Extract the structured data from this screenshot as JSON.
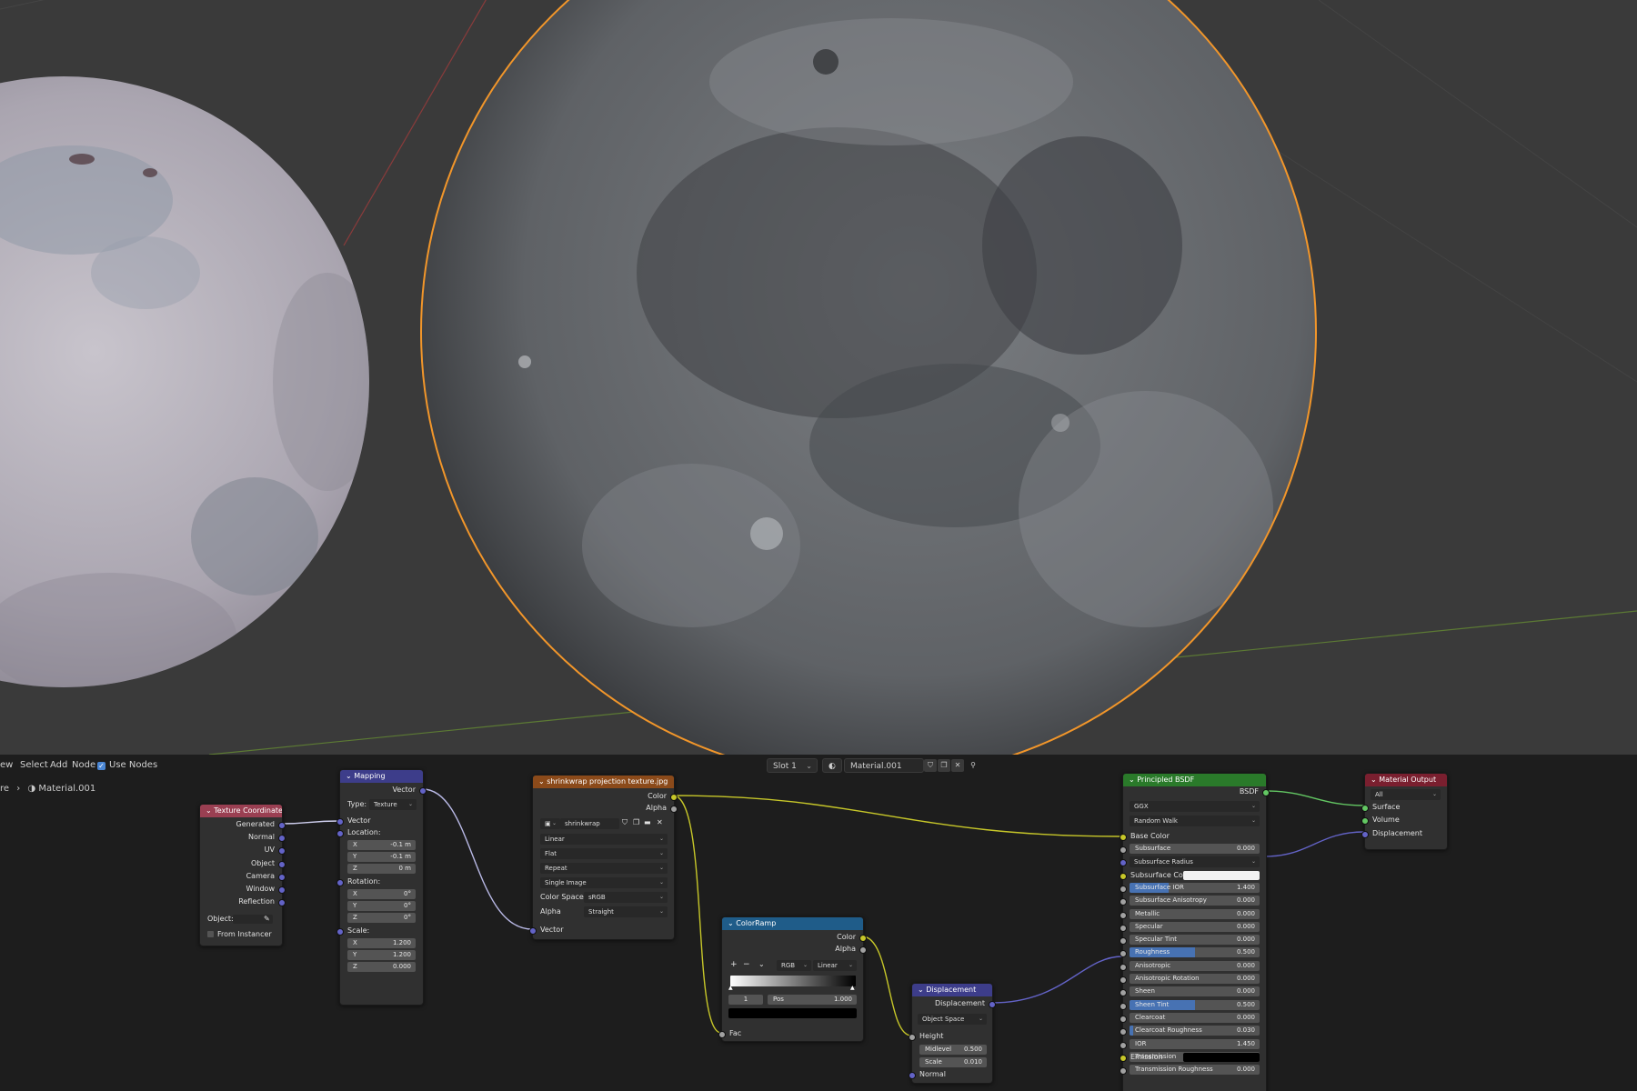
{
  "colors": {
    "texture_coordinate_header": "#9a3f52",
    "mapping_header": "#3d3d8a",
    "image_texture_header": "#8b4a1a",
    "colorramp_header": "#1f5c89",
    "displacement_header": "#3d3d8a",
    "principled_header": "#2a7a2a",
    "output_header": "#7a1f2f",
    "socket_vector": "#6363c7",
    "socket_color": "#c7c729",
    "socket_float": "#a1a1a1",
    "socket_shader": "#63c763",
    "selection_outline": "#f2962a"
  },
  "header": {
    "view_label": "ew",
    "select_label": "Select",
    "add_label": "Add",
    "node_label": "Node",
    "use_nodes_label": "Use Nodes",
    "slot_label": "Slot 1",
    "material_name": "Material.001"
  },
  "breadcrumb": {
    "prefix": "re",
    "separator": "›",
    "material": "Material.001"
  },
  "nodes": {
    "texture_coordinate": {
      "title": "Texture Coordinate",
      "outputs": [
        "Generated",
        "Normal",
        "UV",
        "Object",
        "Camera",
        "Window",
        "Reflection"
      ],
      "object_label": "Object:",
      "from_instancer": "From Instancer"
    },
    "mapping": {
      "title": "Mapping",
      "output": "Vector",
      "type_label": "Type:",
      "type_value": "Texture",
      "vector_input": "Vector",
      "location_label": "Location:",
      "location": [
        {
          "axis": "X",
          "value": "-0.1 m"
        },
        {
          "axis": "Y",
          "value": "-0.1 m"
        },
        {
          "axis": "Z",
          "value": "0 m"
        }
      ],
      "rotation_label": "Rotation:",
      "rotation": [
        {
          "axis": "X",
          "value": "0°"
        },
        {
          "axis": "Y",
          "value": "0°"
        },
        {
          "axis": "Z",
          "value": "0°"
        }
      ],
      "scale_label": "Scale:",
      "scale": [
        {
          "axis": "X",
          "value": "1.200"
        },
        {
          "axis": "Y",
          "value": "1.200"
        },
        {
          "axis": "Z",
          "value": "0.000"
        }
      ]
    },
    "image_texture": {
      "title": "shrinkwrap projection texture.jpg",
      "outputs": [
        "Color",
        "Alpha"
      ],
      "image_name": "shrinkwrap proje...",
      "interpolation": "Linear",
      "projection": "Flat",
      "extension": "Repeat",
      "source": "Single Image",
      "color_space_label": "Color Space",
      "color_space": "sRGB",
      "alpha_label": "Alpha",
      "alpha": "Straight",
      "vector_input": "Vector"
    },
    "colorramp": {
      "title": "ColorRamp",
      "outputs": [
        "Color",
        "Alpha"
      ],
      "add": "+",
      "remove": "−",
      "mode": "RGB",
      "interpolation": "Linear",
      "index": "1",
      "pos_label": "Pos",
      "pos_value": "1.000",
      "fac_input": "Fac"
    },
    "displacement": {
      "title": "Displacement",
      "output": "Displacement",
      "space": "Object Space",
      "height": "Height",
      "midlevel_label": "Midlevel",
      "midlevel": "0.500",
      "scale_label": "Scale",
      "scale": "0.010",
      "normal": "Normal"
    },
    "principled": {
      "title": "Principled BSDF",
      "output": "BSDF",
      "distribution": "GGX",
      "subsurface_method": "Random Walk",
      "base_color": "Base Color",
      "params": [
        {
          "label": "Subsurface",
          "value": "0.000",
          "fill": 0
        },
        {
          "label": "Subsurface Radius",
          "value": "",
          "fill": 0
        },
        {
          "label": "Subsurface Col",
          "value": "",
          "fill": 0
        },
        {
          "label": "Subsurface IOR",
          "value": "1.400",
          "fill": 0.3
        },
        {
          "label": "Subsurface Anisotropy",
          "value": "0.000",
          "fill": 0
        },
        {
          "label": "Metallic",
          "value": "0.000",
          "fill": 0
        },
        {
          "label": "Specular",
          "value": "0.000",
          "fill": 0
        },
        {
          "label": "Specular Tint",
          "value": "0.000",
          "fill": 0
        },
        {
          "label": "Roughness",
          "value": "0.500",
          "fill": 0.5
        },
        {
          "label": "Anisotropic",
          "value": "0.000",
          "fill": 0
        },
        {
          "label": "Anisotropic Rotation",
          "value": "0.000",
          "fill": 0
        },
        {
          "label": "Sheen",
          "value": "0.000",
          "fill": 0
        },
        {
          "label": "Sheen Tint",
          "value": "0.500",
          "fill": 0.5
        },
        {
          "label": "Clearcoat",
          "value": "0.000",
          "fill": 0
        },
        {
          "label": "Clearcoat Roughness",
          "value": "0.030",
          "fill": 0.03
        },
        {
          "label": "IOR",
          "value": "1.450",
          "fill": 0
        },
        {
          "label": "Transmission",
          "value": "0.000",
          "fill": 0
        },
        {
          "label": "Transmission Roughness",
          "value": "0.000",
          "fill": 0
        }
      ],
      "emission": "Emission"
    },
    "material_output": {
      "title": "Material Output",
      "target": "All",
      "inputs": [
        "Surface",
        "Volume",
        "Displacement"
      ]
    }
  }
}
